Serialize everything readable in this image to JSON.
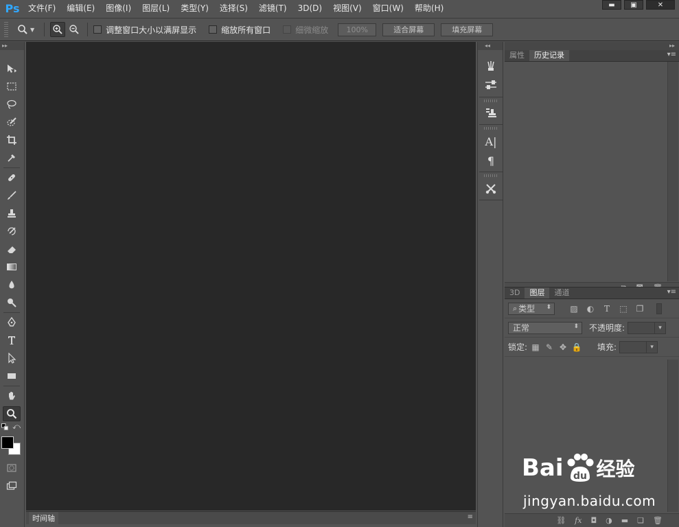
{
  "app": {
    "logo": "Ps"
  },
  "menu": [
    "文件(F)",
    "编辑(E)",
    "图像(I)",
    "图层(L)",
    "类型(Y)",
    "选择(S)",
    "滤镜(T)",
    "3D(D)",
    "视图(V)",
    "窗口(W)",
    "帮助(H)"
  ],
  "window_controls": {
    "minimize": "▬",
    "maximize": "▣",
    "close": "✕"
  },
  "options": {
    "resize_windows_label": "调整窗口大小以满屏显示",
    "zoom_all_windows_label": "缩放所有窗口",
    "scrubby_zoom_label": "细微缩放",
    "zoom_value": "100%",
    "fit_screen_label": "适合屏幕",
    "fill_screen_label": "填充屏幕"
  },
  "timeline": {
    "tab_label": "时间轴",
    "menu_icon": "≡"
  },
  "history_panel": {
    "tabs": [
      "属性",
      "历史记录"
    ],
    "active_tab": "历史记录"
  },
  "layers_panel": {
    "tabs": [
      "3D",
      "图层",
      "通道"
    ],
    "active_tab": "图层",
    "filter_kind": "类型",
    "blend_mode": "正常",
    "opacity_label": "不透明度:",
    "lock_label": "锁定:",
    "fill_label": "填充:"
  },
  "watermark": {
    "logo_text": "Bai du 经验",
    "url": "jingyan.baidu.com"
  },
  "colors": {
    "foreground": "#000000",
    "background": "#ffffff",
    "canvas_bg": "#282828",
    "accent": "#31a8ff"
  }
}
